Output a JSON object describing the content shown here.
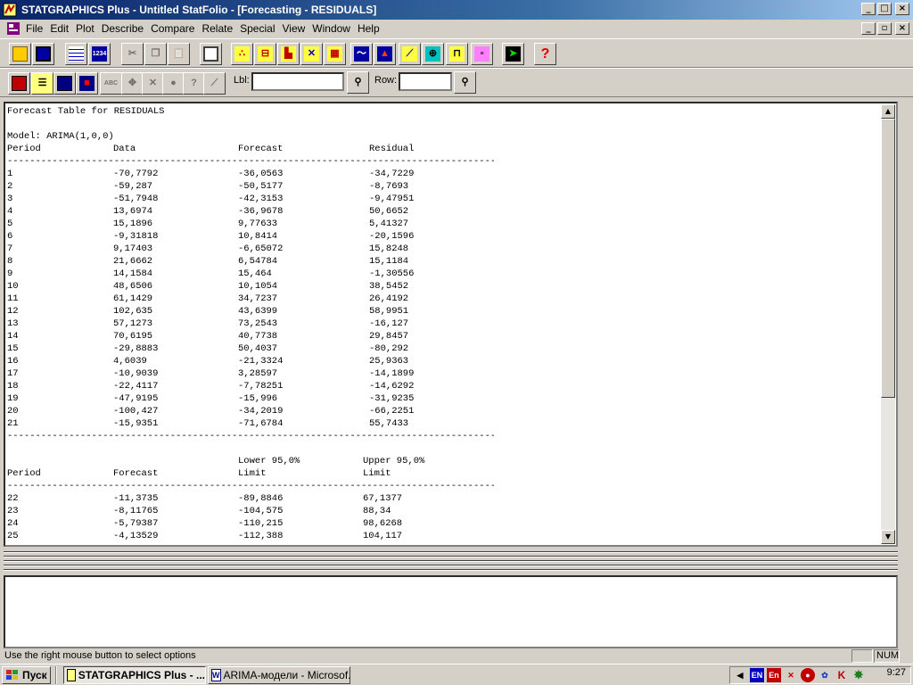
{
  "window": {
    "title": "STATGRAPHICS Plus - Untitled StatFolio - [Forecasting - RESIDUALS]",
    "controls": {
      "minimize": "_",
      "restore": "□",
      "close": "×"
    },
    "doc_controls": {
      "minimize": "_",
      "restore": "▫",
      "close": "×"
    }
  },
  "menu": {
    "items": [
      "File",
      "Edit",
      "Plot",
      "Describe",
      "Compare",
      "Relate",
      "Special",
      "View",
      "Window",
      "Help"
    ]
  },
  "toolbar2": {
    "lbl_label": "Lbl:",
    "lbl_value": "",
    "row_label": "Row:",
    "row_value": ""
  },
  "document": {
    "heading": "Forecast Table for RESIDUALS",
    "model": "Model: ARIMA(1,0,0)",
    "table1": {
      "headers": [
        "Period",
        "Data",
        "Forecast",
        "Residual"
      ],
      "rows": [
        [
          "1",
          "-70,7792",
          "-36,0563",
          "-34,7229"
        ],
        [
          "2",
          "-59,287",
          "-50,5177",
          "-8,7693"
        ],
        [
          "3",
          "-51,7948",
          "-42,3153",
          "-9,47951"
        ],
        [
          "4",
          "13,6974",
          "-36,9678",
          "50,6652"
        ],
        [
          "5",
          "15,1896",
          "9,77633",
          "5,41327"
        ],
        [
          "6",
          "-9,31818",
          "10,8414",
          "-20,1596"
        ],
        [
          "7",
          "9,17403",
          "-6,65072",
          "15,8248"
        ],
        [
          "8",
          "21,6662",
          "6,54784",
          "15,1184"
        ],
        [
          "9",
          "14,1584",
          "15,464",
          "-1,30556"
        ],
        [
          "10",
          "48,6506",
          "10,1054",
          "38,5452"
        ],
        [
          "11",
          "61,1429",
          "34,7237",
          "26,4192"
        ],
        [
          "12",
          "102,635",
          "43,6399",
          "58,9951"
        ],
        [
          "13",
          "57,1273",
          "73,2543",
          "-16,127"
        ],
        [
          "14",
          "70,6195",
          "40,7738",
          "29,8457"
        ],
        [
          "15",
          "-29,8883",
          "50,4037",
          "-80,292"
        ],
        [
          "16",
          "4,6039",
          "-21,3324",
          "25,9363"
        ],
        [
          "17",
          "-10,9039",
          "3,28597",
          "-14,1899"
        ],
        [
          "18",
          "-22,4117",
          "-7,78251",
          "-14,6292"
        ],
        [
          "19",
          "-47,9195",
          "-15,996",
          "-31,9235"
        ],
        [
          "20",
          "-100,427",
          "-34,2019",
          "-66,2251"
        ],
        [
          "21",
          "-15,9351",
          "-71,6784",
          "55,7433"
        ]
      ]
    },
    "table2": {
      "header_top": [
        "",
        "",
        "Lower 95,0%",
        "Upper 95,0%"
      ],
      "headers": [
        "Period",
        "Forecast",
        "Limit",
        "Limit"
      ],
      "rows": [
        [
          "22",
          "-11,3735",
          "-89,8846",
          "67,1377"
        ],
        [
          "23",
          "-8,11765",
          "-104,575",
          "88,34"
        ],
        [
          "24",
          "-5,79387",
          "-110,215",
          "98,6268"
        ],
        [
          "25",
          "-4,13529",
          "-112,388",
          "104,117"
        ]
      ]
    },
    "separator": "--------------------------------------------------------------------------------------------------------------"
  },
  "scrollbar": {
    "up": "▲",
    "down": "▼"
  },
  "status": {
    "text": "Use the right mouse button to select options",
    "num": "NUM"
  },
  "taskbar": {
    "start": "Пуск",
    "tasks": [
      "STATGRAPHICS Plus - ...",
      "ARIMA-модели - Microsof..."
    ],
    "tray": [
      "EN",
      "En"
    ],
    "clock": "9:27"
  },
  "colors": {
    "title_start": "#0a246a",
    "title_end": "#a6caf0",
    "face": "#d4d0c8"
  }
}
